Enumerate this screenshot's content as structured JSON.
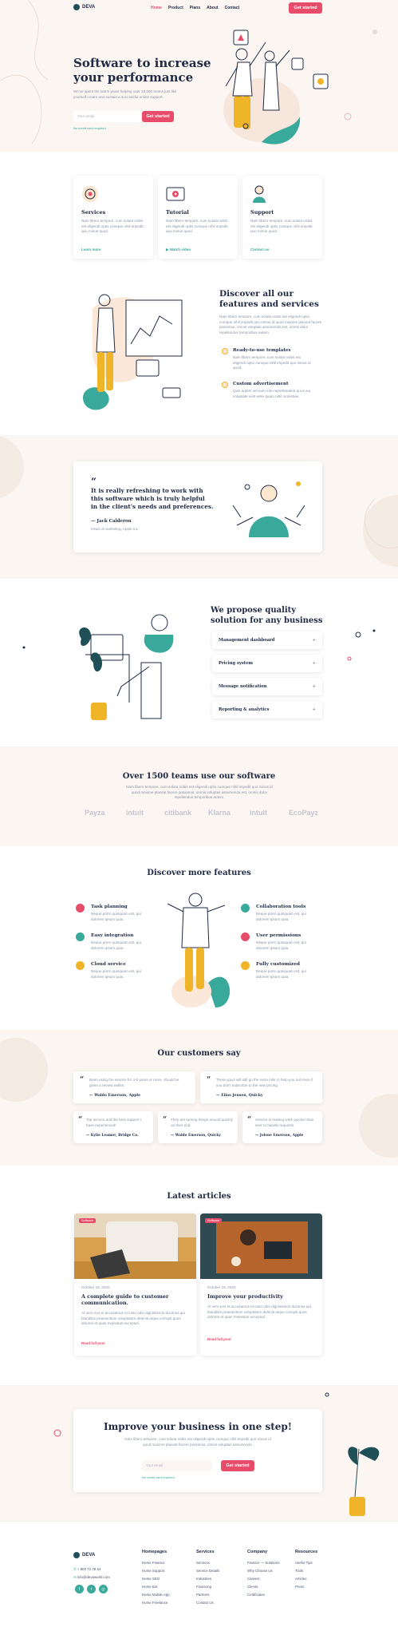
{
  "nav": {
    "brand": "DEVA",
    "items": [
      "Home",
      "Product",
      "Plans",
      "About",
      "Contact"
    ],
    "cta": "Get started"
  },
  "hero": {
    "title_line1": "Software to increase",
    "title_line2": "your performance",
    "subtitle": "We've spent the last 5 years helping over 20,000 teams just like yourself create and sustain a successful online support.",
    "email_placeholder": "Your email",
    "cta": "Get started",
    "note": "No credit card required"
  },
  "services": [
    {
      "title": "Services",
      "text": "Nam libero tempore, cum soluta nobis est eligendi optio cumque nihil impedit quo minus quod.",
      "link": "Learn more",
      "icon": "gear-badge-icon"
    },
    {
      "title": "Tutorial",
      "text": "Nam libero tempore, cum soluta nobis est eligendi optio cumque nihil impedit quo minus quod.",
      "link": "Watch video",
      "icon": "video-play-icon"
    },
    {
      "title": "Support",
      "text": "Nam libero tempore, cum soluta nobis est eligendi optio cumque nihil impedit quo minus quod.",
      "link": "Contact us",
      "icon": "support-agent-icon"
    }
  ],
  "discover": {
    "title_line1": "Discover all our",
    "title_line2": "features and services",
    "text": "Nam libero tempore, cum soluta nobis est eligendi optio cumque nihil impedit quo minus id quod maxime placeat facere possimus, omnis voluptas assumenda est, omnis dolor repellendus temporibus autem.",
    "items": [
      {
        "title": "Ready-to-use templates",
        "text": "Nam libero tempore, cum soluta nobis est eligendi optio cumque nihil impedit quo minus id quod."
      },
      {
        "title": "Custom advertisement",
        "text": "Quis autem vel eum iure reprehenderit qui in ea voluptate velit esse quam nihil molestiae."
      }
    ]
  },
  "testimonial": {
    "quote_line1": "It is really refreshing to work with",
    "quote_line2": "this software which is truly helpful",
    "quote_line3": "in the client's needs and preferences.",
    "author": "— Jack Calderon",
    "role": "Head of marketing, Apple Inc."
  },
  "quality": {
    "title_line1": "We propose quality",
    "title_line2": "solution for any business",
    "accordion": [
      "Management dashboard",
      "Pricing system",
      "Message notification",
      "Reporting & analytics"
    ]
  },
  "teams": {
    "title": "Over 1500 teams use our software",
    "text": "Nam libero tempore, cum soluta nobis est eligendi optio cumque nihil impedit quo minus id quod maxime placeat facere possimus, omnis voluptas assumenda est, omnis dolor repellendus temporibus autem.",
    "logos": [
      "Payza",
      "intuit",
      "citibank",
      "Klarna",
      "intuit",
      "EcoPayz"
    ]
  },
  "more_features": {
    "title": "Discover more features",
    "left": [
      {
        "title": "Task planning",
        "text": "Neque porro quisquam est, qui dolorem ipsum quia."
      },
      {
        "title": "Easy integration",
        "text": "Neque porro quisquam est, qui dolorem ipsum quia."
      },
      {
        "title": "Cloud service",
        "text": "Neque porro quisquam est, qui dolorem ipsum quia."
      }
    ],
    "right": [
      {
        "title": "Collaboration tools",
        "text": "Neque porro quisquam est, qui dolorem ipsum quia."
      },
      {
        "title": "User permissions",
        "text": "Neque porro quisquam est, qui dolorem ipsum quia."
      },
      {
        "title": "Fully customized",
        "text": "Neque porro quisquam est, qui dolorem ipsum quia."
      }
    ]
  },
  "customers": {
    "title": "Our customers say",
    "reviews": [
      {
        "text": "Been using the service for 4-5 years or more, should've given a review earlier.",
        "author": "— Waldo Emerson, Apple"
      },
      {
        "text": "These guys will still go the extra mile to help you out even if you don't subscribe to the new pricing.",
        "author": "— Elias Jensen, Quicky"
      },
      {
        "text": "Top service and the best support I have experienced!",
        "author": "— Kylie Leamer, Bridge Co."
      },
      {
        "text": "They are turning things around quickly on their end.",
        "author": "— Waldo Emerson, Quicky"
      },
      {
        "text": "Service is making work quicker than ever to handle requests.",
        "author": "— Jolene Emerson, Apple"
      }
    ]
  },
  "articles": {
    "title": "Latest articles",
    "items": [
      {
        "tag": "Software",
        "date": "October 16, 2020",
        "title_line1": "A complete guide to customer",
        "title_line2": "communication.",
        "text": "At vero eos et accusamus et iusto odio dignissimos ducimus qui blanditiis praesentium voluptatum deleniti atque corrupti quos dolores et quas molestias excepturi.",
        "link": "Read full post"
      },
      {
        "tag": "Software",
        "date": "October 16, 2020",
        "title_line1": "Improve your productivity",
        "title_line2": "",
        "text": "At vero eos et accusamus et iusto odio dignissimos ducimus qui blanditiis praesentium voluptatum deleniti atque corrupti quos dolores et quas molestias excepturi.",
        "link": "Read full post"
      }
    ]
  },
  "cta_section": {
    "title": "Improve your business in one step!",
    "text": "Nam libero tempore, cum soluta nobis est eligendi optio cumque nihil impedit quo minus id quod maxime placeat facere possimus, omnis voluptas assumenda.",
    "email_placeholder": "Your email",
    "cta": "Get started",
    "note": "No credit card required"
  },
  "footer": {
    "brand": "DEVA",
    "phone": "+ 800 72 78 54",
    "email": "info@devaworld.com",
    "socials": [
      "facebook-icon",
      "twitter-icon",
      "instagram-icon"
    ],
    "columns": [
      {
        "title": "Homepages",
        "links": [
          "Home Finance",
          "Home Support",
          "Home SEO",
          "Home Bot",
          "Home Mobile App",
          "Home Freelance"
        ]
      },
      {
        "title": "Services",
        "links": [
          "Services",
          "Service Details",
          "Industries",
          "Financing",
          "Partners",
          "Contact Us"
        ]
      },
      {
        "title": "Company",
        "links": [
          "Finance — Solutions",
          "Why Choose Us",
          "Careers",
          "Clients",
          "Certificates"
        ]
      },
      {
        "title": "Resources",
        "links": [
          "Useful Tips",
          "Tools",
          "Articles",
          "Press"
        ]
      }
    ]
  },
  "colors": {
    "accent": "#e84c6b",
    "teal": "#38a99b",
    "yellow": "#f0b429",
    "navy": "#1f2a44",
    "cream": "#fbf6f2"
  }
}
